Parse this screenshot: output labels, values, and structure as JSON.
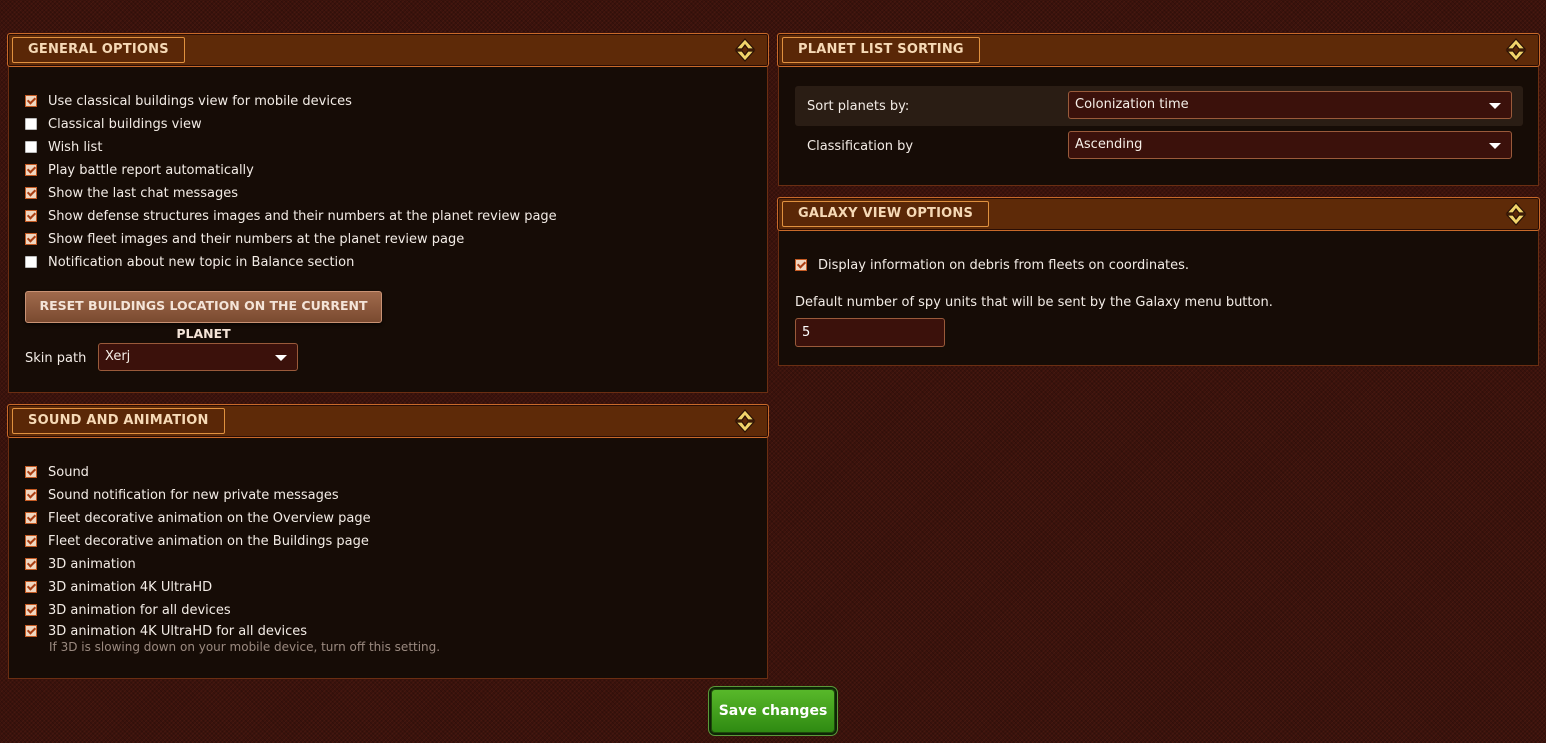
{
  "general": {
    "title": "GENERAL OPTIONS",
    "items": [
      {
        "label": "Use classical buildings view for mobile devices",
        "checked": true
      },
      {
        "label": "Classical buildings view",
        "checked": false
      },
      {
        "label": "Wish list",
        "checked": false
      },
      {
        "label": "Play battle report automatically",
        "checked": true
      },
      {
        "label": "Show the last chat messages",
        "checked": true
      },
      {
        "label": "Show defense structures images and their numbers at the planet review page",
        "checked": true
      },
      {
        "label": "Show fleet images and their numbers at the planet review page",
        "checked": true
      },
      {
        "label": "Notification about new topic in Balance section",
        "checked": false
      }
    ],
    "reset_button": "RESET BUILDINGS LOCATION ON THE CURRENT PLANET",
    "skin_label": "Skin path",
    "skin_value": "Xerj"
  },
  "sound": {
    "title": "SOUND AND ANIMATION",
    "items": [
      {
        "label": "Sound",
        "checked": true
      },
      {
        "label": "Sound notification for new private messages",
        "checked": true
      },
      {
        "label": "Fleet decorative animation on the Overview page",
        "checked": true
      },
      {
        "label": "Fleet decorative animation on the Buildings page",
        "checked": true
      },
      {
        "label": "3D animation",
        "checked": true
      },
      {
        "label": "3D animation 4K UltraHD",
        "checked": true
      },
      {
        "label": "3D animation for all devices",
        "checked": true
      },
      {
        "label": "3D animation 4K UltraHD for all devices",
        "checked": true
      }
    ],
    "hint": "If 3D is slowing down on your mobile device, turn off this setting."
  },
  "planet_sorting": {
    "title": "PLANET LIST SORTING",
    "sort_label": "Sort planets by:",
    "sort_value": "Colonization time",
    "class_label": "Classification by",
    "class_value": "Ascending"
  },
  "galaxy": {
    "title": "GALAXY VIEW OPTIONS",
    "debris_label": "Display information on debris from fleets on coordinates.",
    "debris_checked": true,
    "spy_label": "Default number of spy units that will be sent by the Galaxy menu button.",
    "spy_value": "5"
  },
  "save_button": "Save changes",
  "icons": {
    "collapse": "collapse-arrows-icon",
    "dropdown": "chevron-down-icon"
  },
  "colors": {
    "accent": "#c96a2a",
    "save": "#3f9d1c",
    "header": "#5e2a08"
  }
}
